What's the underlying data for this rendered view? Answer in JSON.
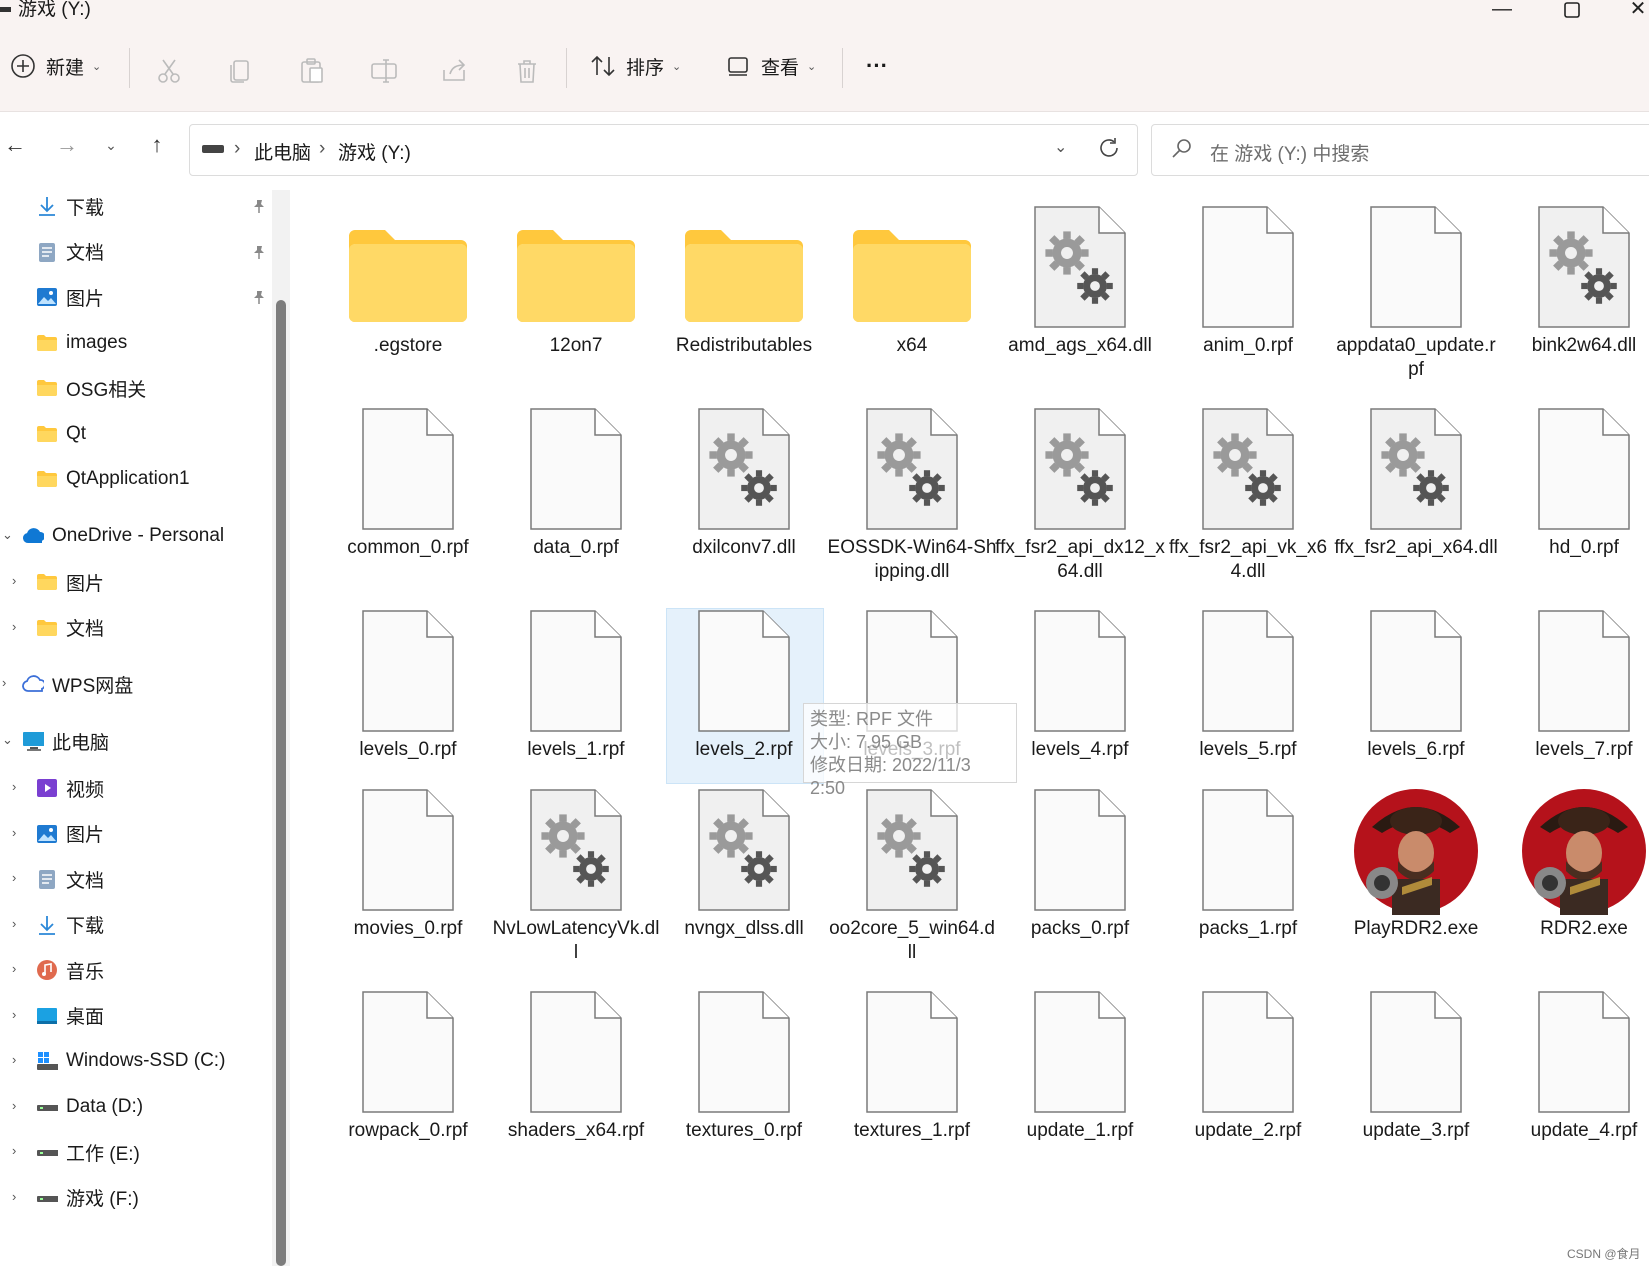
{
  "window": {
    "title": "游戏 (Y:)"
  },
  "toolbar": {
    "new_label": "新建",
    "sort_label": "排序",
    "view_label": "查看",
    "more_label": "···"
  },
  "address": {
    "crumb_pc": "此电脑",
    "crumb_drive": "游戏 (Y:)",
    "search_placeholder": "在 游戏 (Y:) 中搜索"
  },
  "sidebar": {
    "quick": [
      {
        "label": "下载",
        "icon": "download-icon",
        "pinned": true
      },
      {
        "label": "文档",
        "icon": "document-icon",
        "pinned": true
      },
      {
        "label": "图片",
        "icon": "pictures-icon",
        "pinned": true
      },
      {
        "label": "images",
        "icon": "folder-icon",
        "pinned": false
      },
      {
        "label": "OSG相关",
        "icon": "folder-icon",
        "pinned": false
      },
      {
        "label": "Qt",
        "icon": "folder-icon",
        "pinned": false
      },
      {
        "label": "QtApplication1",
        "icon": "folder-icon",
        "pinned": false
      }
    ],
    "onedrive": {
      "label": "OneDrive - Personal",
      "children": [
        "图片",
        "文档"
      ]
    },
    "wps": {
      "label": "WPS网盘"
    },
    "thispc": {
      "label": "此电脑",
      "children": [
        {
          "label": "视频",
          "icon": "videos-icon"
        },
        {
          "label": "图片",
          "icon": "pictures-icon"
        },
        {
          "label": "文档",
          "icon": "document-icon"
        },
        {
          "label": "下载",
          "icon": "download-icon"
        },
        {
          "label": "音乐",
          "icon": "music-icon"
        },
        {
          "label": "桌面",
          "icon": "desktop-icon"
        },
        {
          "label": "Windows-SSD (C:)",
          "icon": "windows-drive-icon"
        },
        {
          "label": "Data (D:)",
          "icon": "drive-icon"
        },
        {
          "label": "工作 (E:)",
          "icon": "drive-icon"
        },
        {
          "label": "游戏 (F:)",
          "icon": "drive-icon"
        }
      ]
    }
  },
  "files": [
    {
      "name": ".egstore",
      "type": "folder"
    },
    {
      "name": "12on7",
      "type": "folder"
    },
    {
      "name": "Redistributables",
      "type": "folder"
    },
    {
      "name": "x64",
      "type": "folder"
    },
    {
      "name": "amd_ags_x64.dll",
      "type": "dll"
    },
    {
      "name": "anim_0.rpf",
      "type": "file"
    },
    {
      "name": "appdata0_update.rpf",
      "type": "file"
    },
    {
      "name": "bink2w64.dll",
      "type": "dll"
    },
    {
      "name": "common_0.rpf",
      "type": "file"
    },
    {
      "name": "data_0.rpf",
      "type": "file"
    },
    {
      "name": "dxilconv7.dll",
      "type": "dll"
    },
    {
      "name": "EOSSDK-Win64-Shipping.dll",
      "type": "dll"
    },
    {
      "name": "ffx_fsr2_api_dx12_x64.dll",
      "type": "dll"
    },
    {
      "name": "ffx_fsr2_api_vk_x64.dll",
      "type": "dll"
    },
    {
      "name": "ffx_fsr2_api_x64.dll",
      "type": "dll"
    },
    {
      "name": "hd_0.rpf",
      "type": "file"
    },
    {
      "name": "levels_0.rpf",
      "type": "file"
    },
    {
      "name": "levels_1.rpf",
      "type": "file"
    },
    {
      "name": "levels_2.rpf",
      "type": "file",
      "selected": true
    },
    {
      "name": "levels_3.rpf",
      "type": "file"
    },
    {
      "name": "levels_4.rpf",
      "type": "file"
    },
    {
      "name": "levels_5.rpf",
      "type": "file"
    },
    {
      "name": "levels_6.rpf",
      "type": "file"
    },
    {
      "name": "levels_7.rpf",
      "type": "file"
    },
    {
      "name": "movies_0.rpf",
      "type": "file"
    },
    {
      "name": "NvLowLatencyVk.dll",
      "type": "dll"
    },
    {
      "name": "nvngx_dlss.dll",
      "type": "dll"
    },
    {
      "name": "oo2core_5_win64.dll",
      "type": "dll"
    },
    {
      "name": "packs_0.rpf",
      "type": "file"
    },
    {
      "name": "packs_1.rpf",
      "type": "file"
    },
    {
      "name": "PlayRDR2.exe",
      "type": "exe"
    },
    {
      "name": "RDR2.exe",
      "type": "exe"
    },
    {
      "name": "rowpack_0.rpf",
      "type": "file"
    },
    {
      "name": "shaders_x64.rpf",
      "type": "file"
    },
    {
      "name": "textures_0.rpf",
      "type": "file"
    },
    {
      "name": "textures_1.rpf",
      "type": "file"
    },
    {
      "name": "update_1.rpf",
      "type": "file"
    },
    {
      "name": "update_2.rpf",
      "type": "file"
    },
    {
      "name": "update_3.rpf",
      "type": "file"
    },
    {
      "name": "update_4.rpf",
      "type": "file"
    }
  ],
  "tooltip": {
    "type_line": "类型: RPF 文件",
    "size_line": "大小: 7.95 GB",
    "date_line": "修改日期: 2022/11/3 2:50"
  },
  "watermark": "CSDN @食月"
}
